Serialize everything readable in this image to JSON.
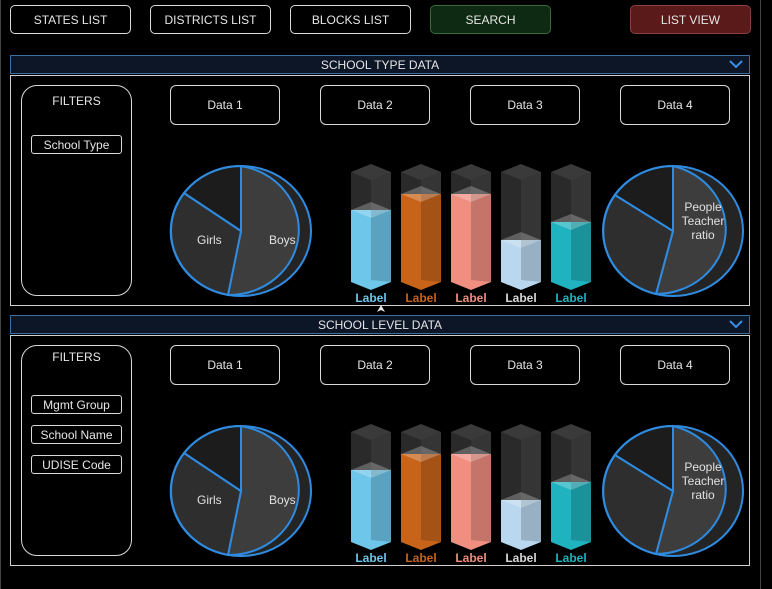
{
  "nav": {
    "states": "STATES LIST",
    "districts": "DISTRICTS LIST",
    "blocks": "BLOCKS LIST",
    "search": "SEARCH",
    "list_view": "LIST VIEW"
  },
  "colors": {
    "search_bg": "#0f2a12",
    "list_view_bg": "#5a1a1a",
    "accent_blue": "#2f8be0",
    "bar_blue": "#6ec6ea",
    "bar_orange": "#c8641a",
    "bar_salmon": "#f08e80",
    "bar_lightblue": "#b9d7ee",
    "bar_teal": "#1fb3bf"
  },
  "sections": [
    {
      "title": "SCHOOL TYPE DATA",
      "filters_title": "FILTERS",
      "filters": [
        "School Type"
      ],
      "data_buttons": [
        "Data 1",
        "Data 2",
        "Data 3",
        "Data 4"
      ],
      "pie_left": {
        "girls": "Girls",
        "boys": "Boys"
      },
      "pie_right": {
        "label_line1": "People",
        "label_line2": "Teacher",
        "label_line3": "ratio"
      },
      "bar_labels": [
        "Label",
        "Label",
        "Label",
        "Label",
        "Label"
      ]
    },
    {
      "title": "SCHOOL LEVEL DATA",
      "filters_title": "FILTERS",
      "filters": [
        "Mgmt Group",
        "School Name",
        "UDISE Code"
      ],
      "data_buttons": [
        "Data 1",
        "Data 2",
        "Data 3",
        "Data 4"
      ],
      "pie_left": {
        "girls": "Girls",
        "boys": "Boys"
      },
      "pie_right": {
        "label_line1": "People",
        "label_line2": "Teacher",
        "label_line3": "ratio"
      },
      "bar_labels": [
        "Label",
        "Label",
        "Label",
        "Label",
        "Label"
      ]
    }
  ]
}
